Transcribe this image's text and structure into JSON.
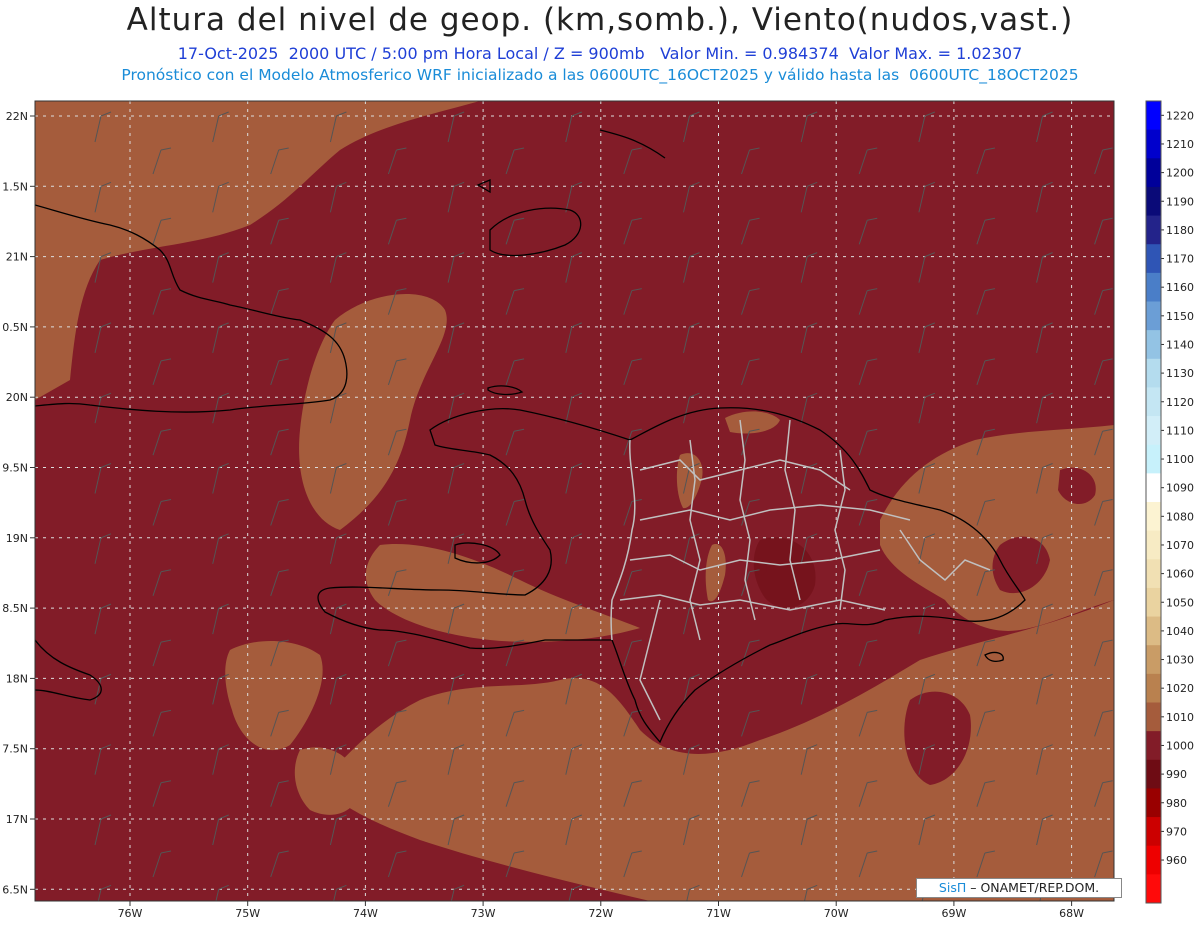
{
  "header": {
    "title": "Altura del nivel de geop. (km,somb.), Viento(nudos,vast.)",
    "subtitle_line1": "17-Oct-2025  2000 UTC / 5:00 pm Hora Local / Z = 900mb   Valor Min. = 0.984374  Valor Max. = 1.02307",
    "subtitle_line2": "Pronóstico con el Modelo Atmosferico WRF inicializado a las 0600UTC_16OCT2025 y válido hasta las  0600UTC_18OCT2025"
  },
  "axes": {
    "lat_labels": [
      "22N",
      "1.5N",
      "21N",
      "0.5N",
      "20N",
      "9.5N",
      "19N",
      "8.5N",
      "18N",
      "7.5N",
      "17N",
      "6.5N"
    ],
    "lon_labels": [
      "76W",
      "75W",
      "74W",
      "73W",
      "72W",
      "71W",
      "70W",
      "69W",
      "68W"
    ]
  },
  "colorbar": {
    "levels": [
      {
        "label": "1220",
        "color": "#0000ff"
      },
      {
        "label": "1210",
        "color": "#0000cc"
      },
      {
        "label": "1200",
        "color": "#00009a"
      },
      {
        "label": "1190",
        "color": "#0a0a78"
      },
      {
        "label": "1180",
        "color": "#23238a"
      },
      {
        "label": "1170",
        "color": "#2f55b5"
      },
      {
        "label": "1160",
        "color": "#4a7ec8"
      },
      {
        "label": "1150",
        "color": "#6b9ed6"
      },
      {
        "label": "1140",
        "color": "#93c3e4"
      },
      {
        "label": "1130",
        "color": "#b4dcee"
      },
      {
        "label": "1120",
        "color": "#c4e6f3"
      },
      {
        "label": "1110",
        "color": "#d2eef8"
      },
      {
        "label": "1100",
        "color": "#c7f1fb"
      },
      {
        "label": "1090",
        "color": "#ffffff"
      },
      {
        "label": "1080",
        "color": "#fcf3d2"
      },
      {
        "label": "1070",
        "color": "#f7ebc4"
      },
      {
        "label": "1060",
        "color": "#f1e0b3"
      },
      {
        "label": "1050",
        "color": "#ead3a0"
      },
      {
        "label": "1040",
        "color": "#dcbb85"
      },
      {
        "label": "1030",
        "color": "#c99c66"
      },
      {
        "label": "1020",
        "color": "#b9814f"
      },
      {
        "label": "1010",
        "color": "#a55c3c"
      },
      {
        "label": "1000",
        "color": "#821c28"
      },
      {
        "label": "990",
        "color": "#6e0c14"
      },
      {
        "label": "980",
        "color": "#990000"
      },
      {
        "label": "970",
        "color": "#cc0000"
      },
      {
        "label": "960",
        "color": "#ee0000"
      },
      {
        "label": "",
        "color": "#ff0a0a"
      }
    ]
  },
  "colors": {
    "field_low": "#821c28",
    "field_high": "#a55c3c",
    "coastline": "#000000",
    "provinces": "#c0c0c0",
    "gridlines": "#dddddd"
  },
  "credit": {
    "brand": "SisΠ",
    "text": "– ONAMET/REP.DOM."
  }
}
